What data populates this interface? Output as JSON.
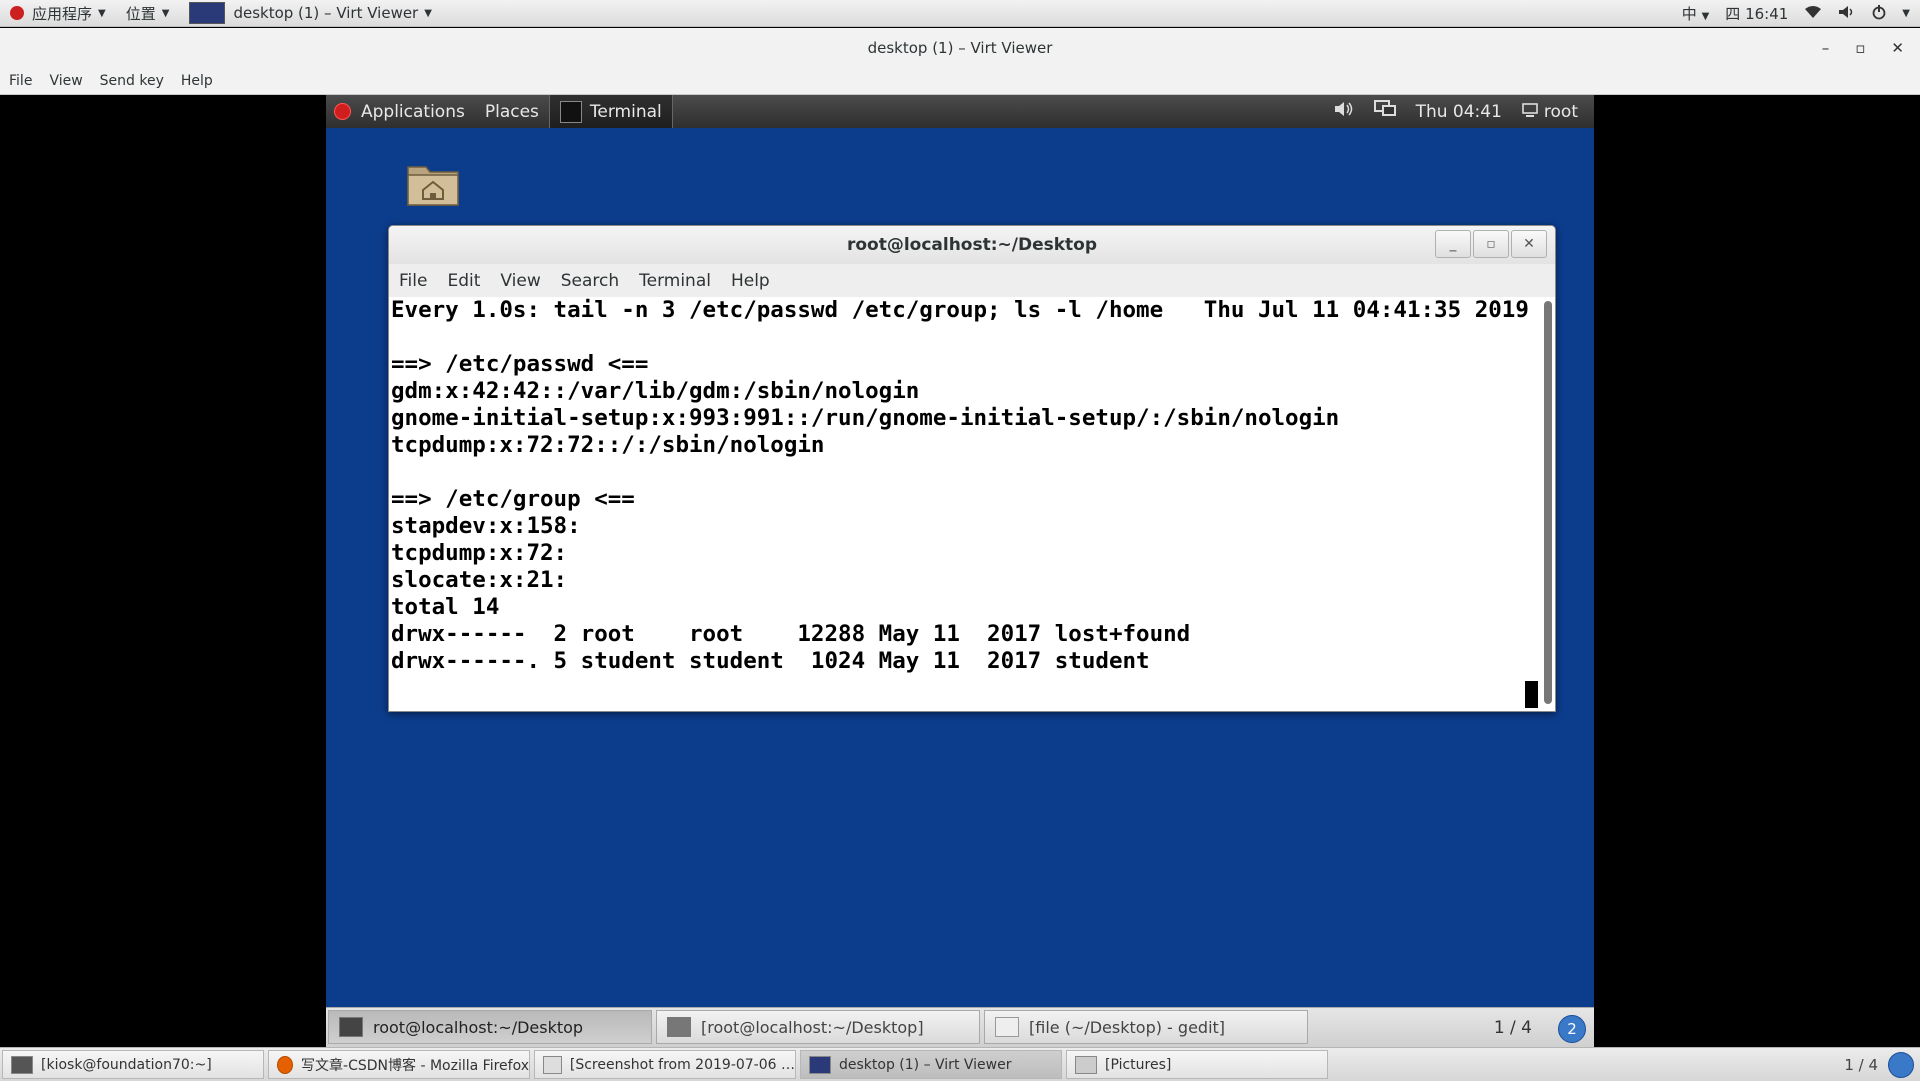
{
  "host_topbar": {
    "applications": "应用程序",
    "places": "位置",
    "window_item": "desktop (1) – Virt Viewer",
    "input_method": "中",
    "clock": "四 16:41"
  },
  "virt_viewer": {
    "title": "desktop (1) – Virt Viewer",
    "menu": [
      "File",
      "View",
      "Send key",
      "Help"
    ]
  },
  "guest_topbar": {
    "applications": "Applications",
    "places": "Places",
    "terminal": "Terminal",
    "clock": "Thu 04:41",
    "user": "root"
  },
  "terminal": {
    "title": "root@localhost:~/Desktop",
    "menu": [
      "File",
      "Edit",
      "View",
      "Search",
      "Terminal",
      "Help"
    ],
    "lines": [
      "Every 1.0s: tail -n 3 /etc/passwd /etc/group; ls -l /home   Thu Jul 11 04:41:35 2019",
      "",
      "==> /etc/passwd <==",
      "gdm:x:42:42::/var/lib/gdm:/sbin/nologin",
      "gnome-initial-setup:x:993:991::/run/gnome-initial-setup/:/sbin/nologin",
      "tcpdump:x:72:72::/:/sbin/nologin",
      "",
      "==> /etc/group <==",
      "stapdev:x:158:",
      "tcpdump:x:72:",
      "slocate:x:21:",
      "total 14",
      "drwx------  2 root    root    12288 May 11  2017 lost+found",
      "drwx------. 5 student student  1024 May 11  2017 student"
    ]
  },
  "guest_taskbar": {
    "tasks": [
      "root@localhost:~/Desktop",
      "[root@localhost:~/Desktop]",
      "[file (~/Desktop) - gedit]"
    ],
    "pager": "1 / 4",
    "workspace": "2"
  },
  "host_taskbar": {
    "tasks": [
      "[kiosk@foundation70:~]",
      "写文章-CSDN博客 - Mozilla Firefox",
      "[Screenshot from 2019-07-06 …",
      "desktop (1) – Virt Viewer",
      "[Pictures]"
    ],
    "pager": "1 / 4"
  }
}
